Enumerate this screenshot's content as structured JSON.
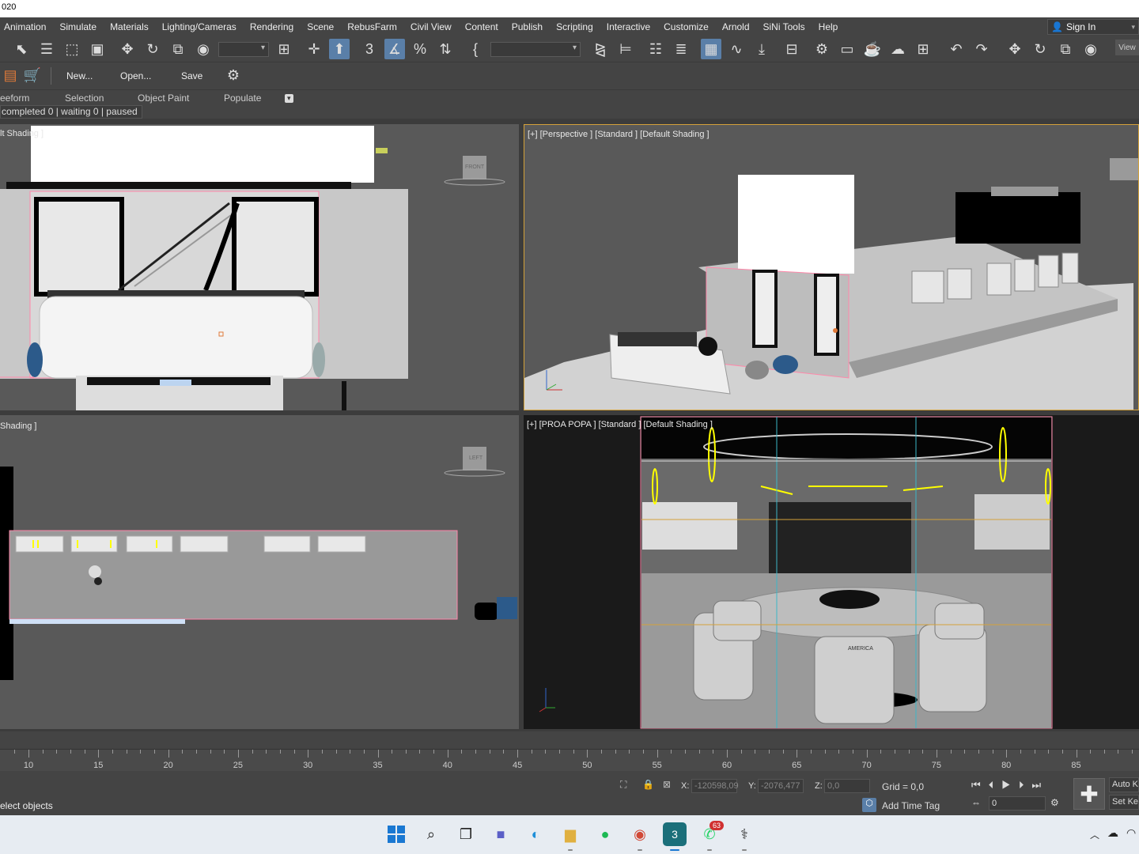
{
  "title": "020",
  "menu": [
    "Animation",
    "Simulate",
    "Materials",
    "Lighting/Cameras",
    "Rendering",
    "Scene",
    "RebusFarm",
    "Civil View",
    "Content",
    "Publish",
    "Scripting",
    "Interactive",
    "Customize",
    "Arnold",
    "SiNi Tools",
    "Help"
  ],
  "signin": "Sign In",
  "view_button": "View",
  "toolbar2": {
    "new": "New...",
    "open": "Open...",
    "save": "Save"
  },
  "ribbon": {
    "freeform": "eeform",
    "selection": "Selection",
    "object_paint": "Object Paint",
    "populate": "Populate"
  },
  "render_status": "completed 0 | waiting 0 | paused 0",
  "viewports": {
    "top_left": {
      "label": "lt Shading ]",
      "cube": "FRONT"
    },
    "top_right": {
      "label": "[+] [Perspective ] [Standard ] [Default Shading ]"
    },
    "bottom_left": {
      "label": "Shading ]",
      "cube": "LEFT"
    },
    "bottom_right": {
      "label": "[+] [PROA POPA ] [Standard ] [Default Shading ]",
      "chair_text": "AMERICA"
    }
  },
  "timeline": {
    "ticks": [
      "10",
      "15",
      "20",
      "25",
      "30",
      "35",
      "40",
      "45",
      "50",
      "55",
      "60",
      "65",
      "70",
      "75",
      "80",
      "85"
    ]
  },
  "bottom": {
    "prompt": "elect objects",
    "x_label": "X:",
    "x_value": "-120598,09",
    "y_label": "Y:",
    "y_value": "-2076,477",
    "z_label": "Z:",
    "z_value": "0,0",
    "grid": "Grid = 0,0",
    "add_time_tag": "Add Time Tag",
    "frame": "0",
    "auto_key": "Auto Ke",
    "set_key": "Set Ke"
  },
  "taskbar": {
    "badge_whatsapp": "63"
  },
  "colors": {
    "accent": "#5a7fa8",
    "select_yellow": "#d4a13a",
    "light_yellow": "#ffff00",
    "viewport_bg": "#595959"
  }
}
